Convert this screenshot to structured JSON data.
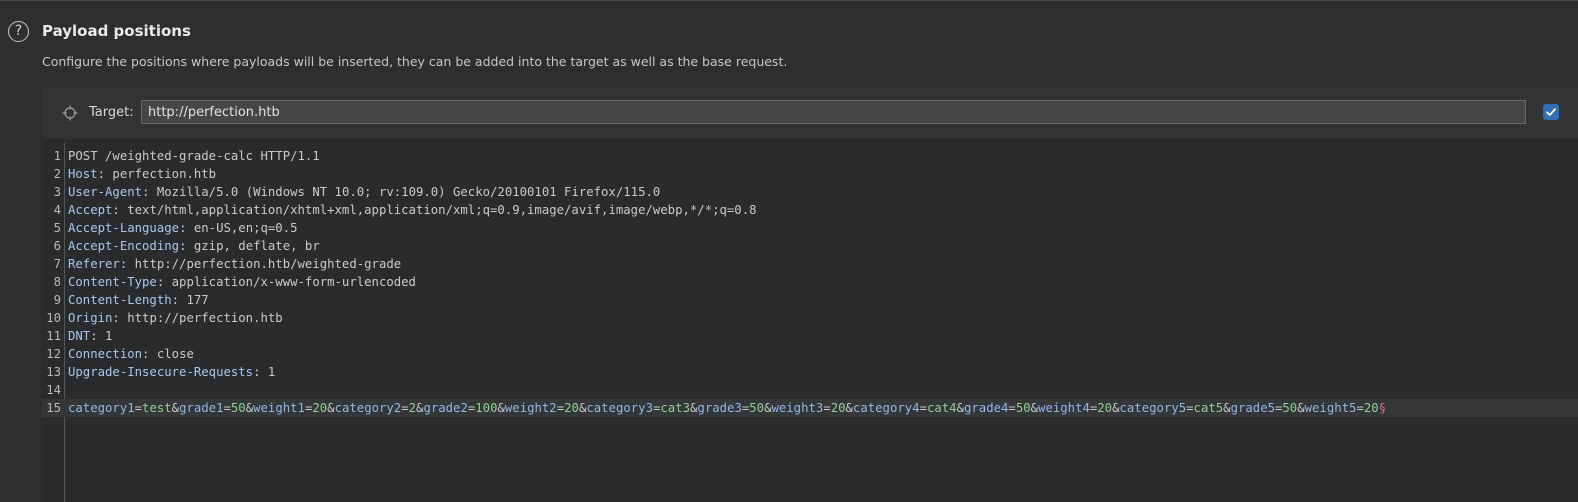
{
  "header": {
    "help_icon": "?",
    "title": "Payload positions",
    "description": "Configure the positions where payloads will be inserted, they can be added into the target as well as the base request."
  },
  "target": {
    "label": "Target:",
    "value": "http://perfection.htb",
    "icon": "crosshair-icon",
    "checkbox_checked": true,
    "checkbox_color": "#2f6fb5"
  },
  "request": {
    "active_line": 15,
    "lines": [
      {
        "n": "1",
        "text": "POST /weighted-grade-calc HTTP/1.1"
      },
      {
        "n": "2",
        "name": "Host",
        "value": " perfection.htb"
      },
      {
        "n": "3",
        "name": "User-Agent",
        "value": " Mozilla/5.0 (Windows NT 10.0; rv:109.0) Gecko/20100101 Firefox/115.0"
      },
      {
        "n": "4",
        "name": "Accept",
        "value": " text/html,application/xhtml+xml,application/xml;q=0.9,image/avif,image/webp,*/*;q=0.8"
      },
      {
        "n": "5",
        "name": "Accept-Language",
        "value": " en-US,en;q=0.5"
      },
      {
        "n": "6",
        "name": "Accept-Encoding",
        "value": " gzip, deflate, br"
      },
      {
        "n": "7",
        "name": "Referer",
        "value": " http://perfection.htb/weighted-grade"
      },
      {
        "n": "8",
        "name": "Content-Type",
        "value": " application/x-www-form-urlencoded"
      },
      {
        "n": "9",
        "name": "Content-Length",
        "value": " 177"
      },
      {
        "n": "10",
        "name": "Origin",
        "value": " http://perfection.htb"
      },
      {
        "n": "11",
        "name": "DNT",
        "value": " 1"
      },
      {
        "n": "12",
        "name": "Connection",
        "value": " close"
      },
      {
        "n": "13",
        "name": "Upgrade-Insecure-Requests",
        "value": " 1"
      },
      {
        "n": "14",
        "text": ""
      }
    ],
    "body_line_number": "15",
    "body_params": [
      {
        "key": "category1",
        "value": "test"
      },
      {
        "key": "grade1",
        "value": "50"
      },
      {
        "key": "weight1",
        "value": "20"
      },
      {
        "key": "category2",
        "value": "2"
      },
      {
        "key": "grade2",
        "value": "100"
      },
      {
        "key": "weight2",
        "value": "20"
      },
      {
        "key": "category3",
        "value": "cat3"
      },
      {
        "key": "grade3",
        "value": "50"
      },
      {
        "key": "weight3",
        "value": "20"
      },
      {
        "key": "category4",
        "value": "cat4"
      },
      {
        "key": "grade4",
        "value": "50"
      },
      {
        "key": "weight4",
        "value": "20"
      },
      {
        "key": "category5",
        "value": "cat5"
      },
      {
        "key": "grade5",
        "value": "50"
      },
      {
        "key": "weight5",
        "value": "20"
      }
    ],
    "payload_marker": "§"
  },
  "colors": {
    "background": "#2d2e30",
    "header_name": "#a9c6ee",
    "param_key": "#8fb8e8",
    "param_value": "#8ed08e",
    "payload_marker": "#e0689a"
  }
}
